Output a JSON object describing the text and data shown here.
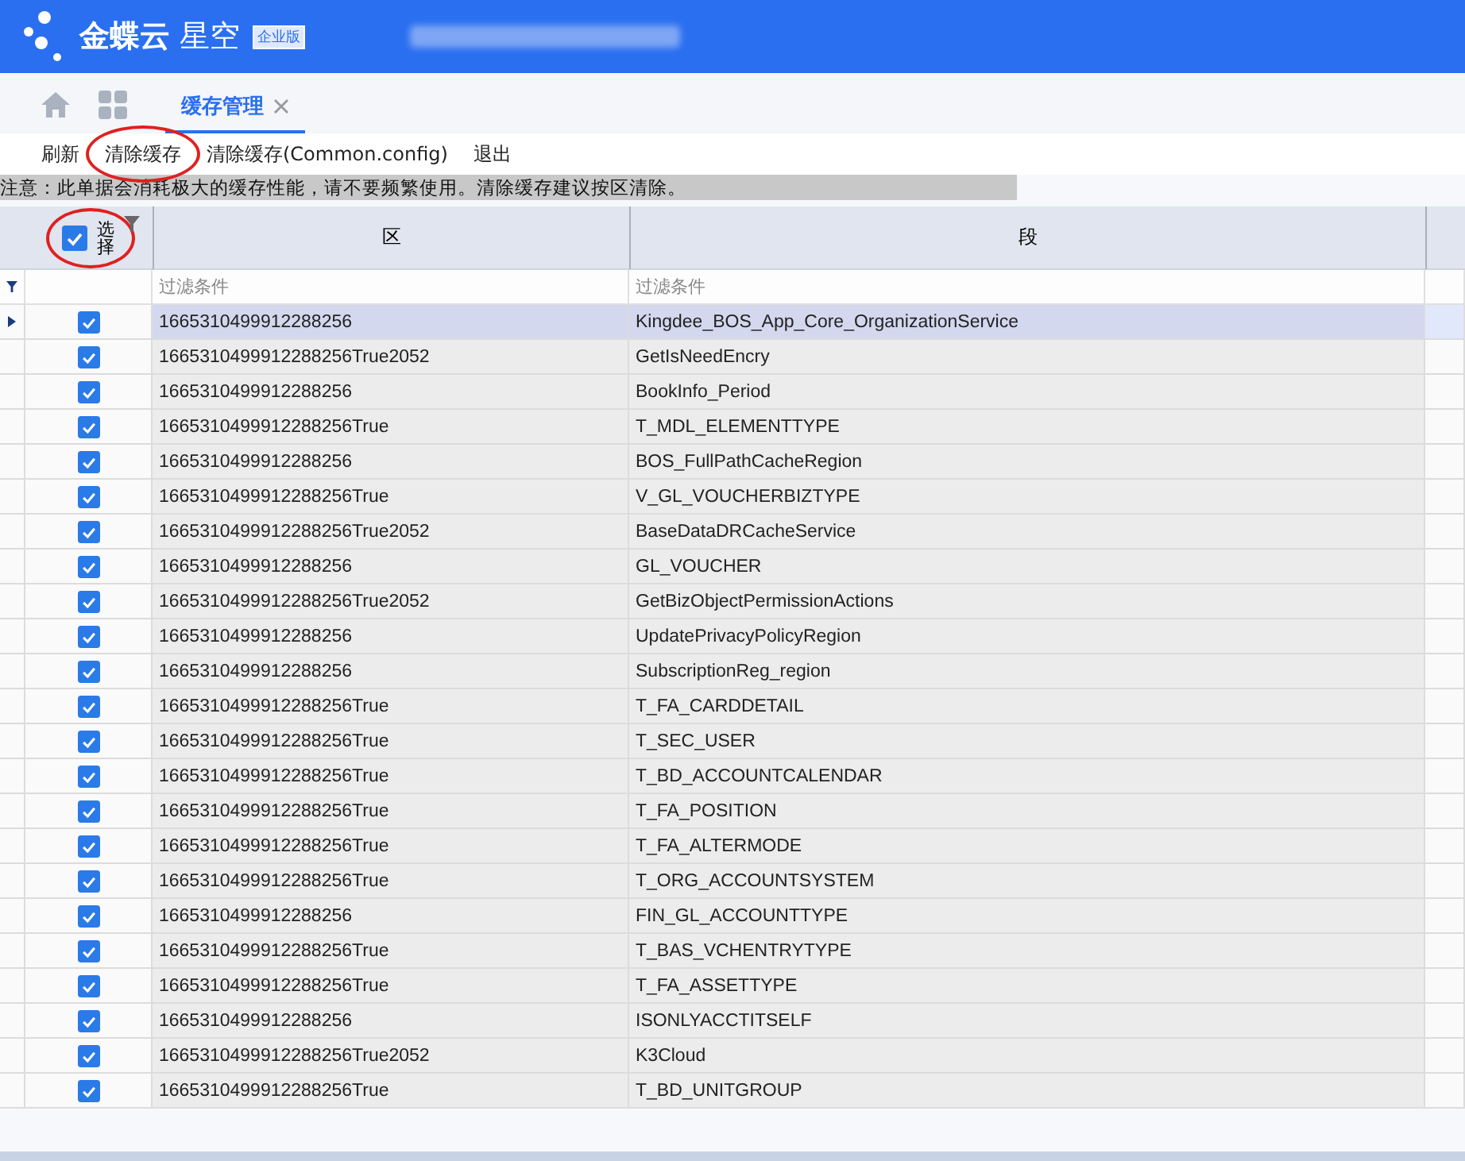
{
  "header": {
    "brand": "金蝶云",
    "product": "星空",
    "edition": "企业版"
  },
  "tabs": [
    {
      "label": "缓存管理",
      "selected": true
    }
  ],
  "toolbar": [
    {
      "label": "刷新",
      "highlighted": false
    },
    {
      "label": "清除缓存",
      "highlighted": true
    },
    {
      "label": "清除缓存(Common.config)",
      "highlighted": false
    },
    {
      "label": "退出",
      "highlighted": false
    }
  ],
  "notice": "注意：此单据会消耗极大的缓存性能，请不要频繁使用。清除缓存建议按区清除。",
  "table": {
    "select_all": {
      "label": "选择",
      "checked": true,
      "highlighted": true
    },
    "columns": [
      "区",
      "段"
    ],
    "filters": [
      "过滤条件",
      "过滤条件"
    ],
    "rows": [
      {
        "region": "1665310499912288256",
        "segment": "Kingdee_BOS_App_Core_OrganizationService",
        "checked": true,
        "selected": true
      },
      {
        "region": "1665310499912288256True2052",
        "segment": "GetIsNeedEncry",
        "checked": true,
        "selected": false
      },
      {
        "region": "1665310499912288256",
        "segment": "BookInfo_Period",
        "checked": true,
        "selected": false
      },
      {
        "region": "1665310499912288256True",
        "segment": "T_MDL_ELEMENTTYPE",
        "checked": true,
        "selected": false
      },
      {
        "region": "1665310499912288256",
        "segment": "BOS_FullPathCacheRegion",
        "checked": true,
        "selected": false
      },
      {
        "region": "1665310499912288256True",
        "segment": "V_GL_VOUCHERBIZTYPE",
        "checked": true,
        "selected": false
      },
      {
        "region": "1665310499912288256True2052",
        "segment": "BaseDataDRCacheService",
        "checked": true,
        "selected": false
      },
      {
        "region": "1665310499912288256",
        "segment": "GL_VOUCHER",
        "checked": true,
        "selected": false
      },
      {
        "region": "1665310499912288256True2052",
        "segment": "GetBizObjectPermissionActions",
        "checked": true,
        "selected": false
      },
      {
        "region": "1665310499912288256",
        "segment": "UpdatePrivacyPolicyRegion",
        "checked": true,
        "selected": false
      },
      {
        "region": "1665310499912288256",
        "segment": "SubscriptionReg_region",
        "checked": true,
        "selected": false
      },
      {
        "region": "1665310499912288256True",
        "segment": "T_FA_CARDDETAIL",
        "checked": true,
        "selected": false
      },
      {
        "region": "1665310499912288256True",
        "segment": "T_SEC_USER",
        "checked": true,
        "selected": false
      },
      {
        "region": "1665310499912288256True",
        "segment": "T_BD_ACCOUNTCALENDAR",
        "checked": true,
        "selected": false
      },
      {
        "region": "1665310499912288256True",
        "segment": "T_FA_POSITION",
        "checked": true,
        "selected": false
      },
      {
        "region": "1665310499912288256True",
        "segment": "T_FA_ALTERMODE",
        "checked": true,
        "selected": false
      },
      {
        "region": "1665310499912288256True",
        "segment": "T_ORG_ACCOUNTSYSTEM",
        "checked": true,
        "selected": false
      },
      {
        "region": "1665310499912288256",
        "segment": "FIN_GL_ACCOUNTTYPE",
        "checked": true,
        "selected": false
      },
      {
        "region": "1665310499912288256True",
        "segment": "T_BAS_VCHENTRYTYPE",
        "checked": true,
        "selected": false
      },
      {
        "region": "1665310499912288256True",
        "segment": "T_FA_ASSETTYPE",
        "checked": true,
        "selected": false
      },
      {
        "region": "1665310499912288256",
        "segment": "ISONLYACCTITSELF",
        "checked": true,
        "selected": false
      },
      {
        "region": "1665310499912288256True2052",
        "segment": "K3Cloud",
        "checked": true,
        "selected": false
      },
      {
        "region": "1665310499912288256True",
        "segment": "T_BD_UNITGROUP",
        "checked": true,
        "selected": false
      }
    ]
  }
}
